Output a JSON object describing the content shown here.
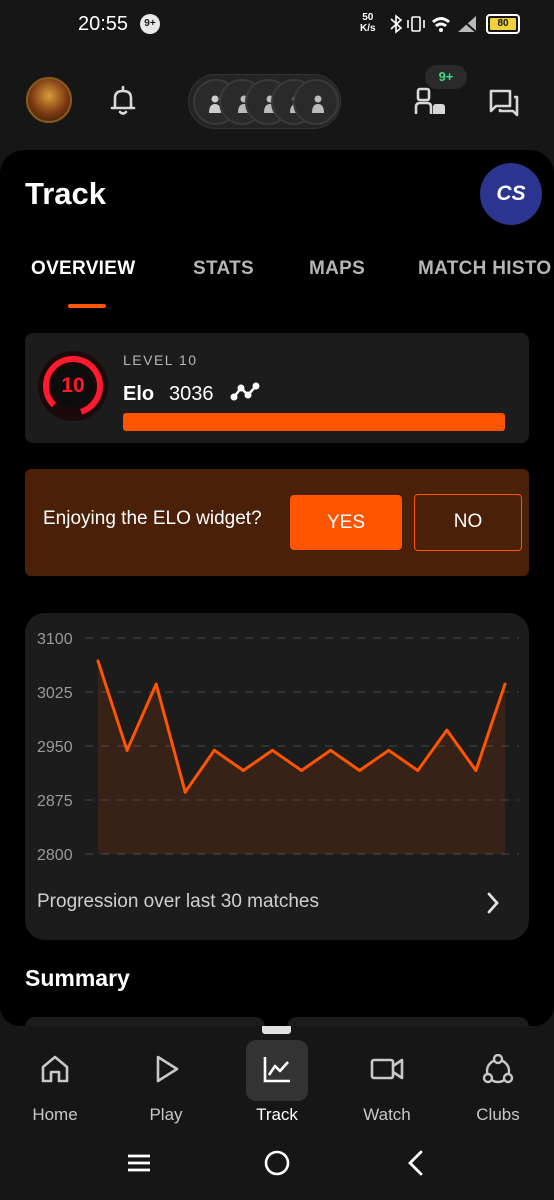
{
  "status_bar": {
    "time": "20:55",
    "notification_badge": "9+",
    "net_speed_value": "50",
    "net_speed_unit": "K/s",
    "battery": "80"
  },
  "top_bar": {
    "friends_badge": "9+",
    "icons": [
      "avatar",
      "bell-icon",
      "party-icon",
      "friends-icon",
      "chat-icon"
    ]
  },
  "page": {
    "title": "Track",
    "game_logo": "CS"
  },
  "tabs": [
    {
      "label": "OVERVIEW",
      "active": true
    },
    {
      "label": "STATS",
      "active": false
    },
    {
      "label": "MAPS",
      "active": false
    },
    {
      "label": "MATCH HISTO",
      "active": false
    }
  ],
  "level_card": {
    "level_label": "LEVEL 10",
    "level_number": "10",
    "elo_label": "Elo",
    "elo_value": "3036",
    "elo_progress": 1.0
  },
  "widget_prompt": {
    "question": "Enjoying the ELO widget?",
    "yes_label": "YES",
    "no_label": "NO"
  },
  "chart_data": {
    "type": "area",
    "title": "",
    "xlabel": "",
    "ylabel": "",
    "ylim": [
      2800,
      3100
    ],
    "yticks": [
      "3100",
      "3025",
      "2950",
      "2875",
      "2800"
    ],
    "grid": true,
    "values": [
      3068,
      2944,
      3036,
      2886,
      2944,
      2916,
      2944,
      2916,
      2944,
      2916,
      2944,
      2916,
      2972,
      2916,
      3036
    ],
    "line_color": "#ff5500"
  },
  "chart_caption": "Progression over last 30 matches",
  "summary": {
    "title": "Summary"
  },
  "bottom_nav": [
    {
      "label": "Home",
      "icon": "home-icon",
      "active": false
    },
    {
      "label": "Play",
      "icon": "play-icon",
      "active": false
    },
    {
      "label": "Track",
      "icon": "track-icon",
      "active": true
    },
    {
      "label": "Watch",
      "icon": "watch-icon",
      "active": false
    },
    {
      "label": "Clubs",
      "icon": "clubs-icon",
      "active": false
    }
  ],
  "colors": {
    "accent": "#ff5500",
    "level_red": "#ff1a2e",
    "prompt_bg": "#4a2008"
  }
}
